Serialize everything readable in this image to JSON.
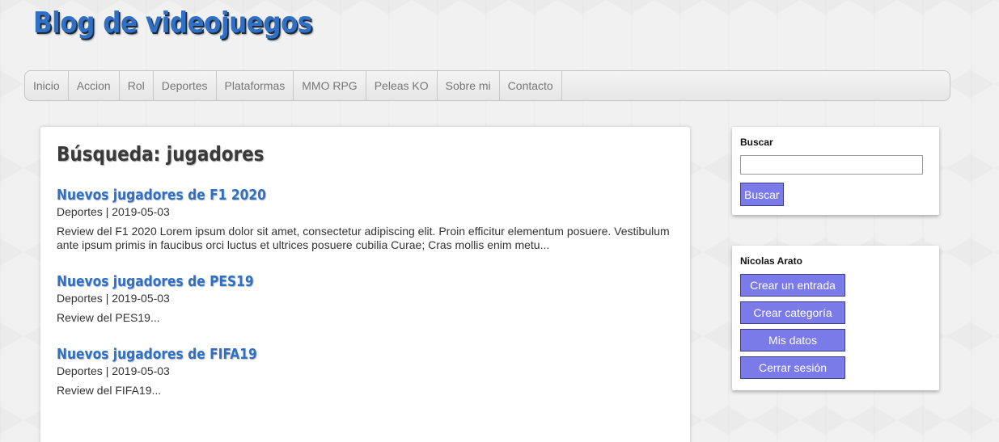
{
  "header": {
    "site_title": "Blog de videojuegos"
  },
  "nav": {
    "items": [
      {
        "label": "Inicio"
      },
      {
        "label": "Accion"
      },
      {
        "label": "Rol"
      },
      {
        "label": "Deportes"
      },
      {
        "label": "Plataformas"
      },
      {
        "label": "MMO RPG"
      },
      {
        "label": "Peleas KO"
      },
      {
        "label": "Sobre mi"
      },
      {
        "label": "Contacto"
      }
    ]
  },
  "main": {
    "page_title": "Búsqueda: jugadores",
    "posts": [
      {
        "title": "Nuevos jugadores de F1 2020",
        "meta": "Deportes | 2019-05-03",
        "excerpt": "Review del F1 2020 Lorem ipsum dolor sit amet, consectetur adipiscing elit. Proin efficitur elementum posuere. Vestibulum ante ipsum primis in faucibus orci luctus et ultrices posuere cubilia Curae; Cras mollis enim metu..."
      },
      {
        "title": "Nuevos jugadores de PES19",
        "meta": "Deportes | 2019-05-03",
        "excerpt": "Review del PES19..."
      },
      {
        "title": "Nuevos jugadores de FIFA19",
        "meta": "Deportes | 2019-05-03",
        "excerpt": "Review del FIFA19..."
      }
    ]
  },
  "sidebar": {
    "search": {
      "title": "Buscar",
      "input_value": "",
      "button_label": "Buscar"
    },
    "user": {
      "name": "Nicolas Arato",
      "buttons": [
        {
          "label": "Crear un entrada"
        },
        {
          "label": "Crear categoría"
        },
        {
          "label": "Mis datos"
        },
        {
          "label": "Cerrar sesión"
        }
      ]
    }
  },
  "colors": {
    "accent_blue": "#2f6fc4",
    "button_purple": "#7a7ae8",
    "page_background": "#f1f1f1"
  }
}
